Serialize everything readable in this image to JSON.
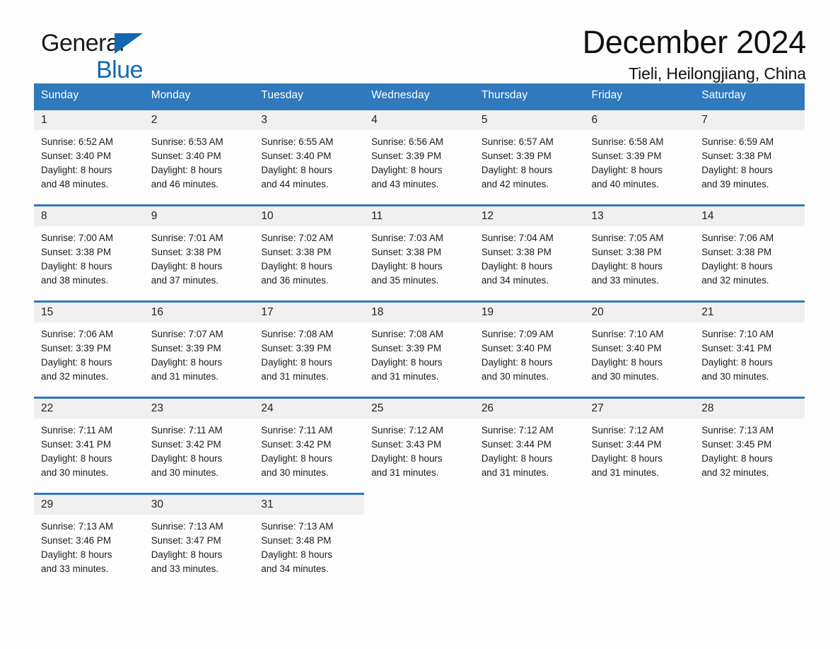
{
  "brand": {
    "name_part1": "General",
    "name_part2": "Blue",
    "accent_color": "#0f6ab4"
  },
  "header": {
    "month_title": "December 2024",
    "location": "Tieli, Heilongjiang, China"
  },
  "calendar": {
    "header_bg": "#2f79bc",
    "daynum_bg": "#f0f0f0",
    "weekday_headers": [
      "Sunday",
      "Monday",
      "Tuesday",
      "Wednesday",
      "Thursday",
      "Friday",
      "Saturday"
    ],
    "weeks": [
      [
        {
          "day": "1",
          "sunrise": "Sunrise: 6:52 AM",
          "sunset": "Sunset: 3:40 PM",
          "daylight_1": "Daylight: 8 hours",
          "daylight_2": "and 48 minutes."
        },
        {
          "day": "2",
          "sunrise": "Sunrise: 6:53 AM",
          "sunset": "Sunset: 3:40 PM",
          "daylight_1": "Daylight: 8 hours",
          "daylight_2": "and 46 minutes."
        },
        {
          "day": "3",
          "sunrise": "Sunrise: 6:55 AM",
          "sunset": "Sunset: 3:40 PM",
          "daylight_1": "Daylight: 8 hours",
          "daylight_2": "and 44 minutes."
        },
        {
          "day": "4",
          "sunrise": "Sunrise: 6:56 AM",
          "sunset": "Sunset: 3:39 PM",
          "daylight_1": "Daylight: 8 hours",
          "daylight_2": "and 43 minutes."
        },
        {
          "day": "5",
          "sunrise": "Sunrise: 6:57 AM",
          "sunset": "Sunset: 3:39 PM",
          "daylight_1": "Daylight: 8 hours",
          "daylight_2": "and 42 minutes."
        },
        {
          "day": "6",
          "sunrise": "Sunrise: 6:58 AM",
          "sunset": "Sunset: 3:39 PM",
          "daylight_1": "Daylight: 8 hours",
          "daylight_2": "and 40 minutes."
        },
        {
          "day": "7",
          "sunrise": "Sunrise: 6:59 AM",
          "sunset": "Sunset: 3:38 PM",
          "daylight_1": "Daylight: 8 hours",
          "daylight_2": "and 39 minutes."
        }
      ],
      [
        {
          "day": "8",
          "sunrise": "Sunrise: 7:00 AM",
          "sunset": "Sunset: 3:38 PM",
          "daylight_1": "Daylight: 8 hours",
          "daylight_2": "and 38 minutes."
        },
        {
          "day": "9",
          "sunrise": "Sunrise: 7:01 AM",
          "sunset": "Sunset: 3:38 PM",
          "daylight_1": "Daylight: 8 hours",
          "daylight_2": "and 37 minutes."
        },
        {
          "day": "10",
          "sunrise": "Sunrise: 7:02 AM",
          "sunset": "Sunset: 3:38 PM",
          "daylight_1": "Daylight: 8 hours",
          "daylight_2": "and 36 minutes."
        },
        {
          "day": "11",
          "sunrise": "Sunrise: 7:03 AM",
          "sunset": "Sunset: 3:38 PM",
          "daylight_1": "Daylight: 8 hours",
          "daylight_2": "and 35 minutes."
        },
        {
          "day": "12",
          "sunrise": "Sunrise: 7:04 AM",
          "sunset": "Sunset: 3:38 PM",
          "daylight_1": "Daylight: 8 hours",
          "daylight_2": "and 34 minutes."
        },
        {
          "day": "13",
          "sunrise": "Sunrise: 7:05 AM",
          "sunset": "Sunset: 3:38 PM",
          "daylight_1": "Daylight: 8 hours",
          "daylight_2": "and 33 minutes."
        },
        {
          "day": "14",
          "sunrise": "Sunrise: 7:06 AM",
          "sunset": "Sunset: 3:38 PM",
          "daylight_1": "Daylight: 8 hours",
          "daylight_2": "and 32 minutes."
        }
      ],
      [
        {
          "day": "15",
          "sunrise": "Sunrise: 7:06 AM",
          "sunset": "Sunset: 3:39 PM",
          "daylight_1": "Daylight: 8 hours",
          "daylight_2": "and 32 minutes."
        },
        {
          "day": "16",
          "sunrise": "Sunrise: 7:07 AM",
          "sunset": "Sunset: 3:39 PM",
          "daylight_1": "Daylight: 8 hours",
          "daylight_2": "and 31 minutes."
        },
        {
          "day": "17",
          "sunrise": "Sunrise: 7:08 AM",
          "sunset": "Sunset: 3:39 PM",
          "daylight_1": "Daylight: 8 hours",
          "daylight_2": "and 31 minutes."
        },
        {
          "day": "18",
          "sunrise": "Sunrise: 7:08 AM",
          "sunset": "Sunset: 3:39 PM",
          "daylight_1": "Daylight: 8 hours",
          "daylight_2": "and 31 minutes."
        },
        {
          "day": "19",
          "sunrise": "Sunrise: 7:09 AM",
          "sunset": "Sunset: 3:40 PM",
          "daylight_1": "Daylight: 8 hours",
          "daylight_2": "and 30 minutes."
        },
        {
          "day": "20",
          "sunrise": "Sunrise: 7:10 AM",
          "sunset": "Sunset: 3:40 PM",
          "daylight_1": "Daylight: 8 hours",
          "daylight_2": "and 30 minutes."
        },
        {
          "day": "21",
          "sunrise": "Sunrise: 7:10 AM",
          "sunset": "Sunset: 3:41 PM",
          "daylight_1": "Daylight: 8 hours",
          "daylight_2": "and 30 minutes."
        }
      ],
      [
        {
          "day": "22",
          "sunrise": "Sunrise: 7:11 AM",
          "sunset": "Sunset: 3:41 PM",
          "daylight_1": "Daylight: 8 hours",
          "daylight_2": "and 30 minutes."
        },
        {
          "day": "23",
          "sunrise": "Sunrise: 7:11 AM",
          "sunset": "Sunset: 3:42 PM",
          "daylight_1": "Daylight: 8 hours",
          "daylight_2": "and 30 minutes."
        },
        {
          "day": "24",
          "sunrise": "Sunrise: 7:11 AM",
          "sunset": "Sunset: 3:42 PM",
          "daylight_1": "Daylight: 8 hours",
          "daylight_2": "and 30 minutes."
        },
        {
          "day": "25",
          "sunrise": "Sunrise: 7:12 AM",
          "sunset": "Sunset: 3:43 PM",
          "daylight_1": "Daylight: 8 hours",
          "daylight_2": "and 31 minutes."
        },
        {
          "day": "26",
          "sunrise": "Sunrise: 7:12 AM",
          "sunset": "Sunset: 3:44 PM",
          "daylight_1": "Daylight: 8 hours",
          "daylight_2": "and 31 minutes."
        },
        {
          "day": "27",
          "sunrise": "Sunrise: 7:12 AM",
          "sunset": "Sunset: 3:44 PM",
          "daylight_1": "Daylight: 8 hours",
          "daylight_2": "and 31 minutes."
        },
        {
          "day": "28",
          "sunrise": "Sunrise: 7:13 AM",
          "sunset": "Sunset: 3:45 PM",
          "daylight_1": "Daylight: 8 hours",
          "daylight_2": "and 32 minutes."
        }
      ],
      [
        {
          "day": "29",
          "sunrise": "Sunrise: 7:13 AM",
          "sunset": "Sunset: 3:46 PM",
          "daylight_1": "Daylight: 8 hours",
          "daylight_2": "and 33 minutes."
        },
        {
          "day": "30",
          "sunrise": "Sunrise: 7:13 AM",
          "sunset": "Sunset: 3:47 PM",
          "daylight_1": "Daylight: 8 hours",
          "daylight_2": "and 33 minutes."
        },
        {
          "day": "31",
          "sunrise": "Sunrise: 7:13 AM",
          "sunset": "Sunset: 3:48 PM",
          "daylight_1": "Daylight: 8 hours",
          "daylight_2": "and 34 minutes."
        },
        {
          "day": "",
          "sunrise": "",
          "sunset": "",
          "daylight_1": "",
          "daylight_2": "",
          "empty": true
        },
        {
          "day": "",
          "sunrise": "",
          "sunset": "",
          "daylight_1": "",
          "daylight_2": "",
          "empty": true
        },
        {
          "day": "",
          "sunrise": "",
          "sunset": "",
          "daylight_1": "",
          "daylight_2": "",
          "empty": true
        },
        {
          "day": "",
          "sunrise": "",
          "sunset": "",
          "daylight_1": "",
          "daylight_2": "",
          "empty": true
        }
      ]
    ]
  }
}
